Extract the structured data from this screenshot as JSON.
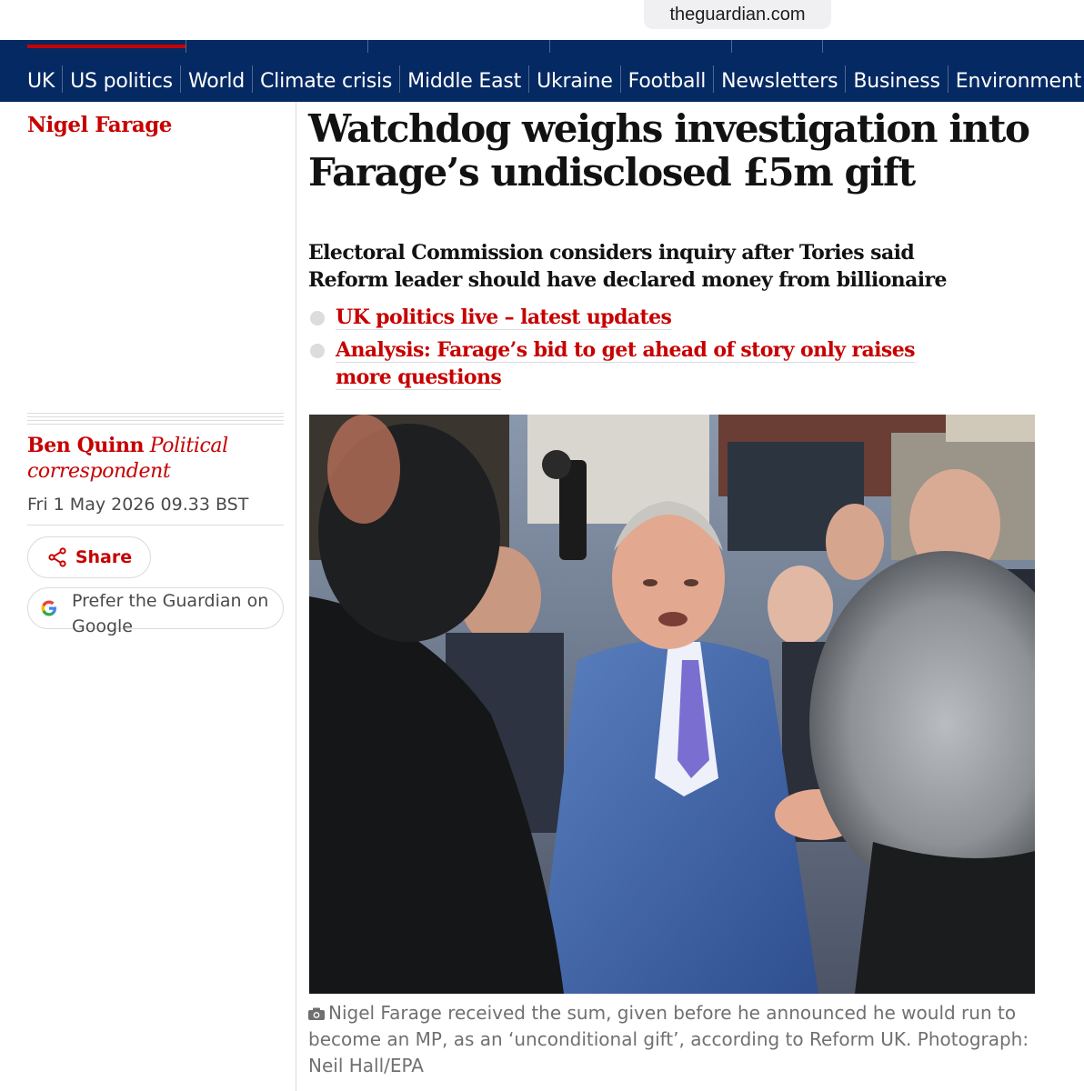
{
  "browser": {
    "url": "theguardian.com"
  },
  "nav": {
    "items": [
      "UK",
      "US politics",
      "World",
      "Climate crisis",
      "Middle East",
      "Ukraine",
      "Football",
      "Newsletters",
      "Business",
      "Environment"
    ],
    "background": "#052962",
    "accent": "#c70000"
  },
  "article": {
    "kicker": "Nigel Farage",
    "headline": "Watchdog weighs investigation into Farage’s undisclosed £5m gift",
    "standfirst": "Electoral Commission considers inquiry after Tories said Reform leader should have declared money from billionaire",
    "related_links": [
      "UK politics live – latest updates",
      "Analysis: Farage’s bid to get ahead of story only raises more questions"
    ],
    "author": "Ben Quinn",
    "author_role": "Political correspondent",
    "dateline": "Fri 1 May 2026 09.33 BST",
    "share_label": "Share",
    "google_label": "Prefer the Guardian on Google",
    "caption": "Nigel Farage received the sum, given before he announced he would run to become an MP, as an ‘unconditional gift’, according to Reform UK.",
    "credit": "Photograph: Neil Hall/EPA"
  },
  "icons": {
    "share": "share-icon",
    "google": "google-g-icon",
    "camera": "camera-icon"
  },
  "colors": {
    "brand_red": "#c70000",
    "navy": "#052962",
    "text": "#121212",
    "caption": "#707070"
  }
}
